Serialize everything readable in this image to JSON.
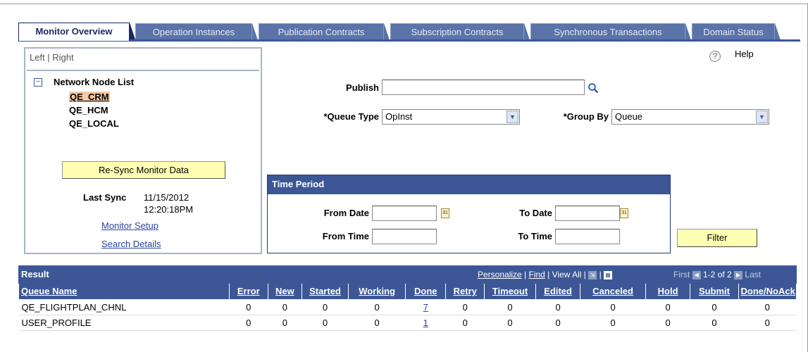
{
  "tabs": [
    {
      "label": "Monitor Overview",
      "active": true
    },
    {
      "label": "Operation Instances",
      "active": false
    },
    {
      "label": "Publication Contracts",
      "active": false
    },
    {
      "label": "Subscription Contracts",
      "active": false
    },
    {
      "label": "Synchronous Transactions",
      "active": false
    },
    {
      "label": "Domain Status",
      "active": false
    }
  ],
  "left_panel": {
    "left_right": "Left | Right",
    "node_list_title": "Network Node List",
    "nodes": [
      "QE_CRM",
      "QE_HCM",
      "QE_LOCAL"
    ],
    "selected_node": "QE_CRM",
    "resync_button": "Re-Sync Monitor Data",
    "last_sync_label": "Last Sync",
    "last_sync_date": "11/15/2012",
    "last_sync_time": "12:20:18PM",
    "monitor_setup_link": "Monitor Setup",
    "search_details_link": "Search Details"
  },
  "help": {
    "icon": "question-icon",
    "label": "Help"
  },
  "filters": {
    "publish_label": "Publish",
    "publish_value": "",
    "queue_type_label": "*Queue Type",
    "queue_type_value": "OpInst",
    "group_by_label": "*Group By",
    "group_by_value": "Queue"
  },
  "time_period": {
    "title": "Time Period",
    "from_date_label": "From Date",
    "to_date_label": "To Date",
    "from_time_label": "From Time",
    "to_time_label": "To Time",
    "from_date": "",
    "to_date": "",
    "from_time": "",
    "to_time": "",
    "filter_button": "Filter"
  },
  "result": {
    "title": "Result",
    "personalize": "Personalize",
    "find": "Find",
    "view_all": "View All",
    "first": "First",
    "range": "1-2 of 2",
    "last": "Last",
    "columns": [
      "Queue Name",
      "Error",
      "New",
      "Started",
      "Working",
      "Done",
      "Retry",
      "Timeout",
      "Edited",
      "Canceled",
      "Hold",
      "Submit",
      "Done/NoAck"
    ],
    "rows": [
      [
        "QE_FLIGHTPLAN_CHNL",
        "0",
        "0",
        "0",
        "0",
        "7",
        "0",
        "0",
        "0",
        "0",
        "0",
        "0",
        "0"
      ],
      [
        "USER_PROFILE",
        "0",
        "0",
        "0",
        "0",
        "1",
        "0",
        "0",
        "0",
        "0",
        "0",
        "0",
        "0"
      ]
    ]
  }
}
